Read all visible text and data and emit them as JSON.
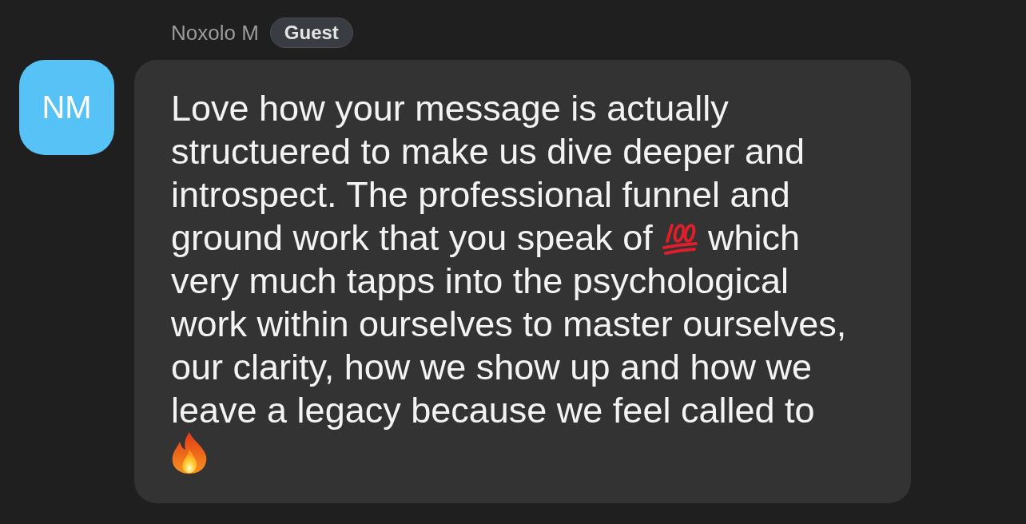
{
  "message": {
    "avatar_initials": "NM",
    "sender": "Noxolo M",
    "role_badge": "Guest",
    "body": [
      {
        "kind": "text",
        "text": "Love how your message is actually structuered to make us dive deeper and introspect. The professional funnel and ground work that you speak of"
      },
      {
        "kind": "hundred"
      },
      {
        "kind": "text",
        "text": "which very much tapps into the psychological work within ourselves to master ourselves, our clarity, how we show up and how we leave a legacy because we feel called to"
      },
      {
        "kind": "fire"
      }
    ]
  }
}
